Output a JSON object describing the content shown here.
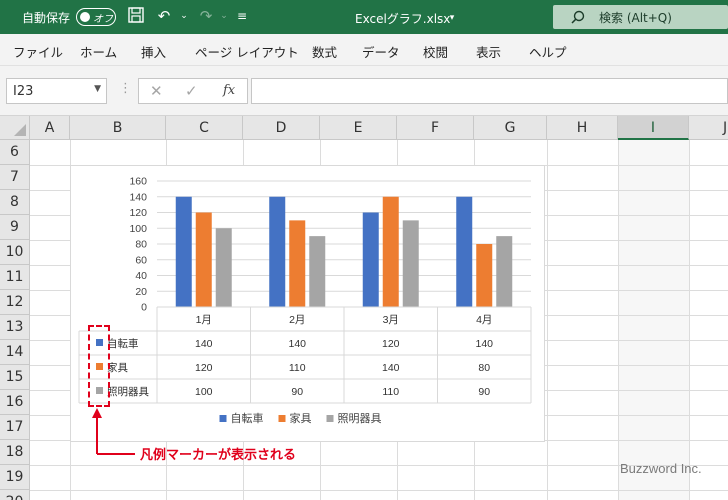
{
  "titlebar": {
    "autosave_label": "自動保存",
    "autosave_state": "オフ",
    "filename": "Excelグラフ.xlsx",
    "search_label": "検索 (Alt+Q)",
    "icons": [
      "save-icon",
      "undo-icon",
      "redo-icon",
      "customize-icon",
      "search-icon"
    ]
  },
  "ribbon": {
    "tabs": [
      "ファイル",
      "ホーム",
      "挿入",
      "ページ レイアウト",
      "数式",
      "データ",
      "校閲",
      "表示",
      "ヘルプ"
    ]
  },
  "formula_bar": {
    "name_box": "I23",
    "formula": ""
  },
  "sheet": {
    "columns": [
      "A",
      "B",
      "C",
      "D",
      "E",
      "F",
      "G",
      "H",
      "I",
      "J"
    ],
    "rows": [
      "6",
      "7",
      "8",
      "9",
      "10",
      "11",
      "12",
      "13",
      "14",
      "15",
      "16",
      "17",
      "18",
      "19",
      "20"
    ],
    "selected_column": "I"
  },
  "chart_data": {
    "type": "bar",
    "categories": [
      "1月",
      "2月",
      "3月",
      "4月"
    ],
    "series": [
      {
        "name": "自転車",
        "values": [
          140,
          140,
          120,
          140
        ],
        "color": "#4472c4"
      },
      {
        "name": "家具",
        "values": [
          120,
          110,
          140,
          80
        ],
        "color": "#ed7d31"
      },
      {
        "name": "照明器具",
        "values": [
          100,
          90,
          110,
          90
        ],
        "color": "#a5a5a5"
      }
    ],
    "ylim": [
      0,
      160
    ],
    "yticks": [
      "0",
      "20",
      "40",
      "60",
      "80",
      "100",
      "120",
      "140",
      "160"
    ],
    "grid": true,
    "data_table": true,
    "legend": "bottom"
  },
  "annotation": {
    "text": "凡例マーカーが表示される",
    "color": "#e0001b"
  },
  "watermark": "Buzzword Inc."
}
